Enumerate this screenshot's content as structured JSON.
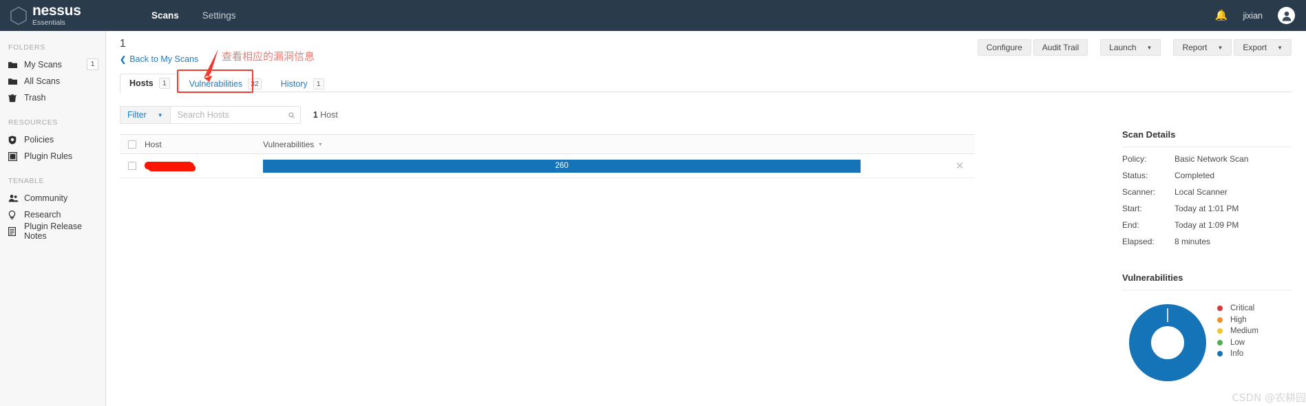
{
  "topnav": {
    "brand_name": "nessus",
    "brand_sub": "Essentials",
    "links": [
      {
        "label": "Scans",
        "active": true
      },
      {
        "label": "Settings",
        "active": false
      }
    ],
    "bell_icon": "bell-icon",
    "username": "jixian",
    "avatar_icon": "user-avatar-icon"
  },
  "sidebar": {
    "groups": [
      {
        "title": "FOLDERS",
        "items": [
          {
            "label": "My Scans",
            "icon": "folder-icon",
            "badge": "1"
          },
          {
            "label": "All Scans",
            "icon": "folder-icon",
            "badge": ""
          },
          {
            "label": "Trash",
            "icon": "trash-icon",
            "badge": ""
          }
        ]
      },
      {
        "title": "RESOURCES",
        "items": [
          {
            "label": "Policies",
            "icon": "shield-icon",
            "badge": ""
          },
          {
            "label": "Plugin Rules",
            "icon": "plugin-icon",
            "badge": ""
          }
        ]
      },
      {
        "title": "TENABLE",
        "items": [
          {
            "label": "Community",
            "icon": "community-icon",
            "badge": ""
          },
          {
            "label": "Research",
            "icon": "lightbulb-icon",
            "badge": ""
          },
          {
            "label": "Plugin Release Notes",
            "icon": "document-icon",
            "badge": ""
          }
        ]
      }
    ]
  },
  "main": {
    "scan_title": "1",
    "back_link": "Back to My Scans",
    "back_chevron": "❮",
    "actions": [
      {
        "label": "Configure",
        "caret": false
      },
      {
        "label": "Audit Trail",
        "caret": false
      },
      {
        "label": "Launch",
        "caret": true
      },
      {
        "label": "Report",
        "caret": true
      },
      {
        "label": "Export",
        "caret": true
      }
    ],
    "tabs": [
      {
        "label": "Hosts",
        "count": "1",
        "active": true
      },
      {
        "label": "Vulnerabilities",
        "count": "32",
        "active": false
      },
      {
        "label": "History",
        "count": "1",
        "active": false
      }
    ],
    "annotation": {
      "text": "查看相应的漏洞信息",
      "color": "#f4776e",
      "arrow_icon": "red-arrow-icon",
      "highlight_color": "#ef3a30"
    },
    "filter": {
      "filter_label": "Filter",
      "caret": "▼",
      "search_value": "",
      "search_placeholder": "Search Hosts",
      "search_icon": "search-icon",
      "count_number": "1",
      "count_unit": "Host"
    },
    "table": {
      "columns": [
        "Host",
        "Vulnerabilities"
      ],
      "sort_caret": "▾",
      "rows": [
        {
          "host": "",
          "host_redacted": true,
          "bar_value": "260",
          "bar_color": "#1573b8",
          "remove_icon": "close-icon"
        }
      ]
    }
  },
  "right_panel": {
    "scan_details_title": "Scan Details",
    "details": [
      {
        "key": "Policy:",
        "value": "Basic Network Scan"
      },
      {
        "key": "Status:",
        "value": "Completed"
      },
      {
        "key": "Scanner:",
        "value": "Local Scanner"
      },
      {
        "key": "Start:",
        "value": "Today at 1:01 PM"
      },
      {
        "key": "End:",
        "value": "Today at 1:09 PM"
      },
      {
        "key": "Elapsed:",
        "value": "8 minutes"
      }
    ],
    "vulnerabilities_title": "Vulnerabilities"
  },
  "chart_data": {
    "type": "pie",
    "title": "Vulnerabilities",
    "subtype": "donut",
    "categories": [
      "Critical",
      "High",
      "Medium",
      "Low",
      "Info"
    ],
    "values": [
      0,
      0,
      0,
      0,
      260
    ],
    "colors": [
      "#d93a3a",
      "#ef8f2e",
      "#f7c52b",
      "#4caf50",
      "#1573b8"
    ],
    "total": 260,
    "legend_position": "right",
    "xlabel": "",
    "ylabel": ""
  },
  "watermark": "CSDN @农耕园"
}
